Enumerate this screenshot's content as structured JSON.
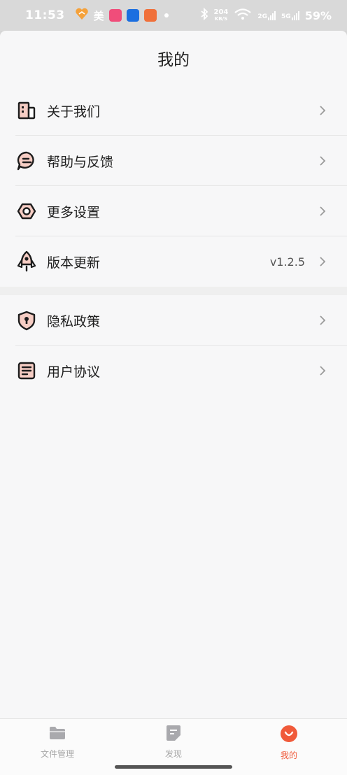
{
  "status_bar": {
    "time": "11:53",
    "mei_label": "美",
    "net_speed_value": "204",
    "net_speed_unit": "KB/S",
    "sim1_tag": "2G",
    "sim2_tag": "5G",
    "battery": "59%"
  },
  "page": {
    "title": "我的"
  },
  "menu_group_1": [
    {
      "label": "关于我们",
      "icon": "building-icon"
    },
    {
      "label": "帮助与反馈",
      "icon": "chat-bubble-icon"
    },
    {
      "label": "更多设置",
      "icon": "settings-nut-icon"
    },
    {
      "label": "版本更新",
      "icon": "rocket-icon",
      "value": "v1.2.5"
    }
  ],
  "menu_group_2": [
    {
      "label": "隐私政策",
      "icon": "shield-lock-icon"
    },
    {
      "label": "用户协议",
      "icon": "document-icon"
    }
  ],
  "tabbar": {
    "tabs": [
      {
        "label": "文件管理",
        "icon": "folder-icon",
        "active": false
      },
      {
        "label": "发现",
        "icon": "note-icon",
        "active": false
      },
      {
        "label": "我的",
        "icon": "smile-icon",
        "active": true
      }
    ]
  },
  "colors": {
    "accent": "#f05a3a",
    "icon_fill": "#f6cdc4",
    "inactive": "#a8a8a8"
  }
}
